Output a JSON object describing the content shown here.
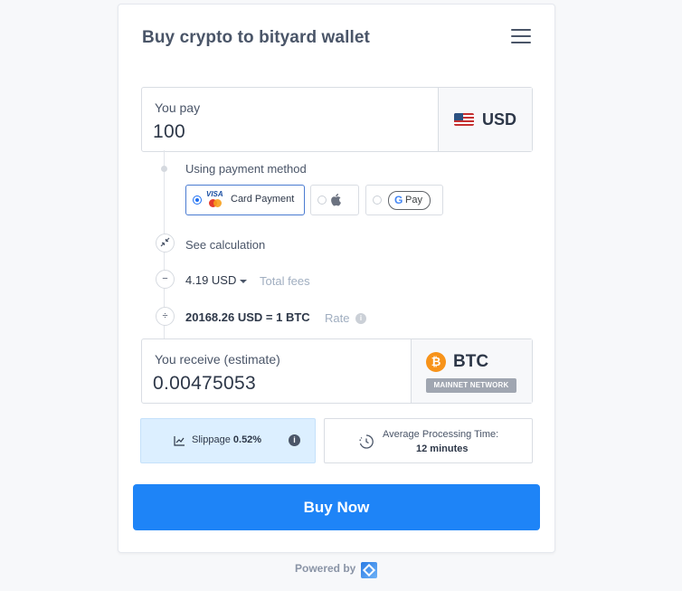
{
  "header": {
    "title": "Buy crypto to bityard wallet"
  },
  "pay": {
    "label": "You pay",
    "amount": "100",
    "currency": "USD",
    "currency_icon": "us-flag-icon"
  },
  "payment_method": {
    "label": "Using payment method",
    "options": [
      {
        "label": "Card Payment",
        "icon": "visa-mastercard-icon",
        "selected": true
      },
      {
        "label": "",
        "icon": "apple-pay-icon",
        "selected": false
      },
      {
        "label": "Pay",
        "icon": "google-pay-icon",
        "selected": false
      }
    ]
  },
  "calculation": {
    "label": "See calculation"
  },
  "fees": {
    "value": "4.19 USD",
    "label": "Total fees"
  },
  "rate": {
    "value": "20168.26 USD = 1 BTC",
    "label": "Rate"
  },
  "receive": {
    "label": "You receive (estimate)",
    "amount": "0.00475053",
    "currency": "BTC",
    "network": "MAINNET NETWORK",
    "currency_icon": "bitcoin-icon"
  },
  "slippage": {
    "label": "Slippage",
    "value": "0.52%"
  },
  "processing": {
    "label": "Average Processing Time:",
    "value": "12 minutes"
  },
  "actions": {
    "buy_label": "Buy Now"
  },
  "footer": {
    "powered_by": "Powered by"
  },
  "colors": {
    "accent": "#1e84f7",
    "slippage_bg": "#dcefff",
    "bitcoin": "#f7931a"
  }
}
